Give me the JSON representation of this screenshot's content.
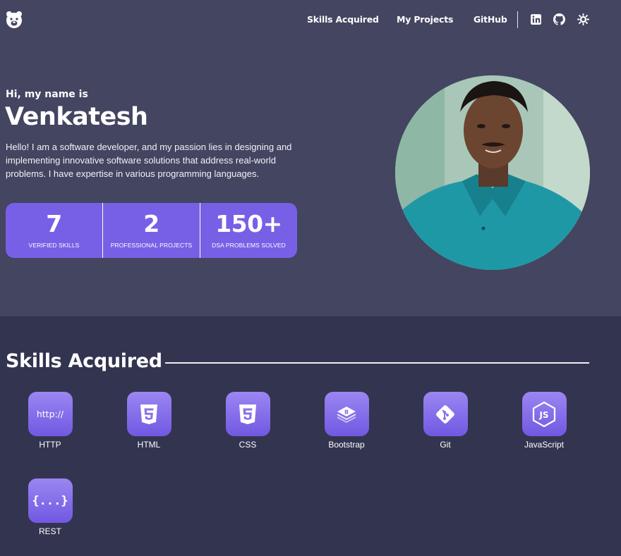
{
  "nav": {
    "links": [
      "Skills Acquired",
      "My Projects",
      "GitHub"
    ],
    "icons": [
      "linkedin-icon",
      "github-icon",
      "theme-toggle-icon"
    ]
  },
  "hero": {
    "greeting": "Hi, my name is",
    "name": "Venkatesh",
    "bio": "Hello! I am a software developer, and my passion lies in designing and implementing innovative software solutions that address real-world problems. I have expertise in various programming languages.",
    "stats": [
      {
        "value": "7",
        "label": "Verified Skills"
      },
      {
        "value": "2",
        "label": "Professional Projects"
      },
      {
        "value": "150+",
        "label": "DSA Problems Solved"
      }
    ]
  },
  "skills": {
    "title": "Skills Acquired",
    "items": [
      {
        "label": "HTTP",
        "icon": "http-icon",
        "icon_text": "http://"
      },
      {
        "label": "HTML",
        "icon": "html5-icon"
      },
      {
        "label": "CSS",
        "icon": "css3-icon"
      },
      {
        "label": "Bootstrap",
        "icon": "bootstrap-icon"
      },
      {
        "label": "Git",
        "icon": "git-icon"
      },
      {
        "label": "JavaScript",
        "icon": "javascript-icon"
      },
      {
        "label": "REST",
        "icon": "rest-api-icon",
        "icon_text": "{...}"
      }
    ]
  },
  "colors": {
    "hero_bg": "#434561",
    "skills_bg": "#333450",
    "accent": "#7860e6"
  }
}
